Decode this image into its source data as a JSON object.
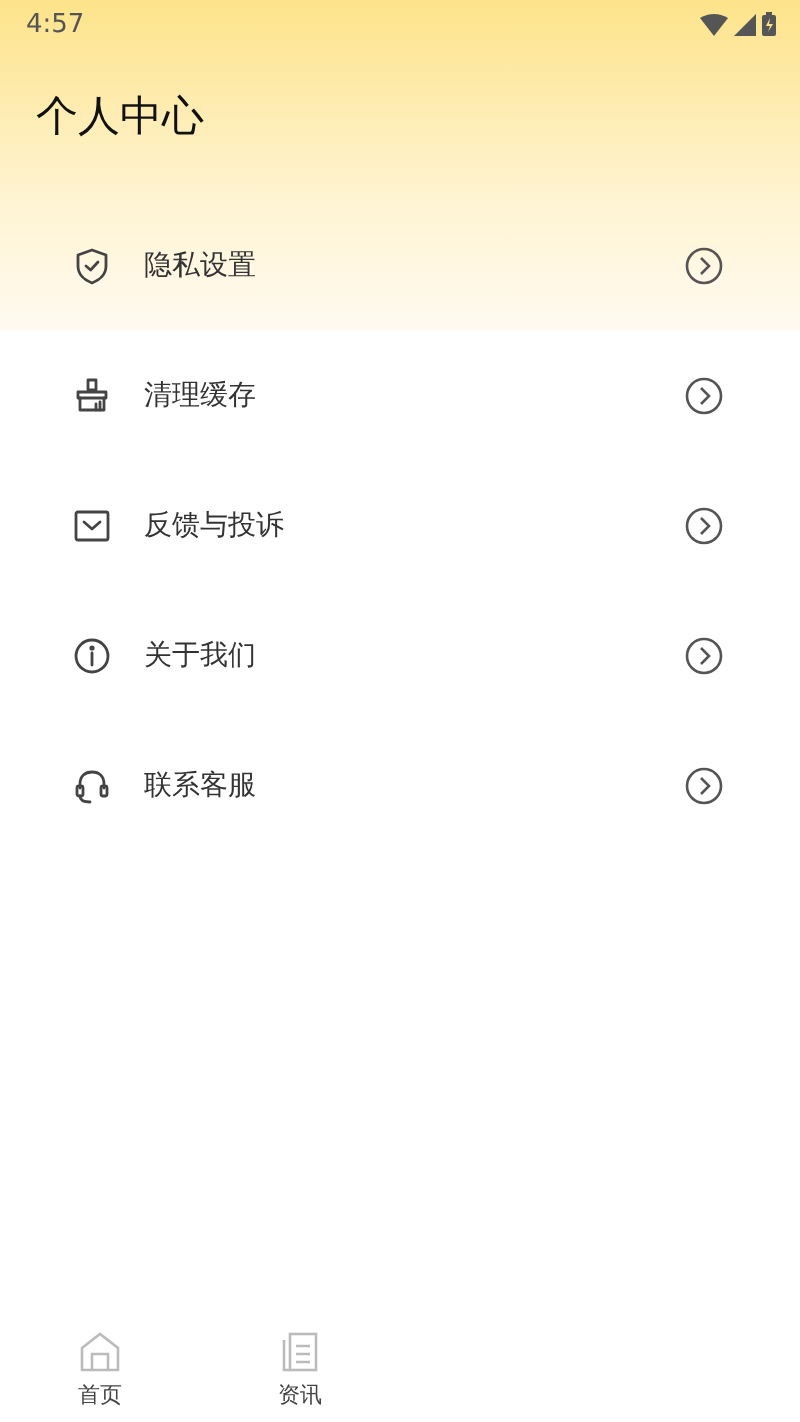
{
  "status_bar": {
    "time": "4:57"
  },
  "title": "个人中心",
  "menu": [
    {
      "kind": "shield",
      "label": "隐私设置"
    },
    {
      "kind": "broom",
      "label": "清理缓存"
    },
    {
      "kind": "mail",
      "label": "反馈与投诉"
    },
    {
      "kind": "info",
      "label": "关于我们"
    },
    {
      "kind": "headset",
      "label": "联系客服"
    }
  ],
  "tab_bar": [
    {
      "kind": "home",
      "label": "首页"
    },
    {
      "kind": "news",
      "label": "资讯"
    }
  ]
}
